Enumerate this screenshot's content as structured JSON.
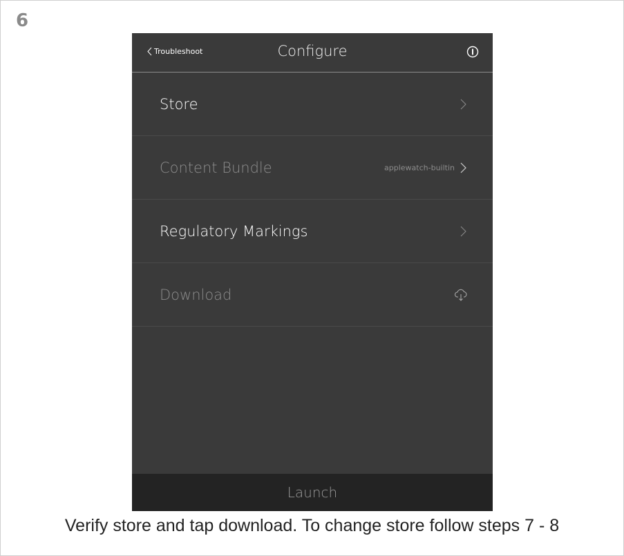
{
  "step": {
    "number": "6"
  },
  "navbar": {
    "back_label": "Troubleshoot",
    "title": "Configure",
    "back_icon": "chevron-left-icon",
    "info_icon": "info-icon"
  },
  "rows": [
    {
      "label": "Store",
      "value": "",
      "icon": "chevron-right-icon",
      "enabled": true
    },
    {
      "label": "Content Bundle",
      "value": "applewatch-builtin",
      "icon": "chevron-right-icon",
      "enabled": false
    },
    {
      "label": "Regulatory Markings",
      "value": "",
      "icon": "chevron-right-icon",
      "enabled": true
    },
    {
      "label": "Download",
      "value": "",
      "icon": "cloud-download-icon",
      "enabled": false
    }
  ],
  "footer": {
    "launch_label": "Launch"
  },
  "caption": "Verify store and tap download. To change store follow steps 7 - 8",
  "colors": {
    "screen_bg": "#3a3a3a",
    "launch_bg": "#232323",
    "enabled_text": "#ffffff",
    "disabled_text": "#8d8d8d",
    "step_number": "#8a8a8a"
  }
}
